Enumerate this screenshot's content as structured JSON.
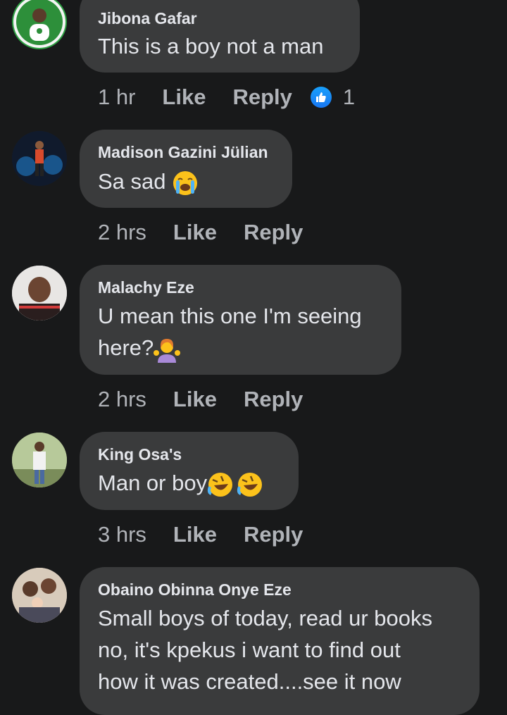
{
  "comments": [
    {
      "author": "Jibona Gafar",
      "lines": [
        "This is a boy not a man"
      ],
      "time": "1 hr",
      "like": "Like",
      "reply": "Reply",
      "reaction_count": "1",
      "avatar_icon": "profile-photo"
    },
    {
      "author": "Madison Gazini Jülian",
      "lines": [
        "Sa sad"
      ],
      "emoji": [
        "loudly-crying-face"
      ],
      "time": "2 hrs",
      "like": "Like",
      "reply": "Reply",
      "avatar_icon": "profile-photo"
    },
    {
      "author": "Malachy Eze",
      "lines": [
        "U mean this one I'm seeing",
        "here?"
      ],
      "emoji": [
        "person-shrugging"
      ],
      "time": "2 hrs",
      "like": "Like",
      "reply": "Reply",
      "avatar_icon": "profile-photo"
    },
    {
      "author": "King Osa's",
      "lines": [
        "Man or boy"
      ],
      "emoji": [
        "rolling-laughing-face",
        "rolling-laughing-face"
      ],
      "time": "3 hrs",
      "like": "Like",
      "reply": "Reply",
      "avatar_icon": "profile-photo"
    },
    {
      "author": "Obaino Obinna Onye Eze",
      "lines": [
        "Small boys of today, read ur books",
        "no, it's kpekus i want to find out",
        "how it was created....see it now"
      ],
      "avatar_icon": "profile-photo"
    }
  ],
  "colors": {
    "background": "#18191a",
    "bubble": "#3a3b3c",
    "primary_text": "#e4e6eb",
    "secondary_text": "#b0b3b8",
    "like_blue": "#1877f2"
  }
}
